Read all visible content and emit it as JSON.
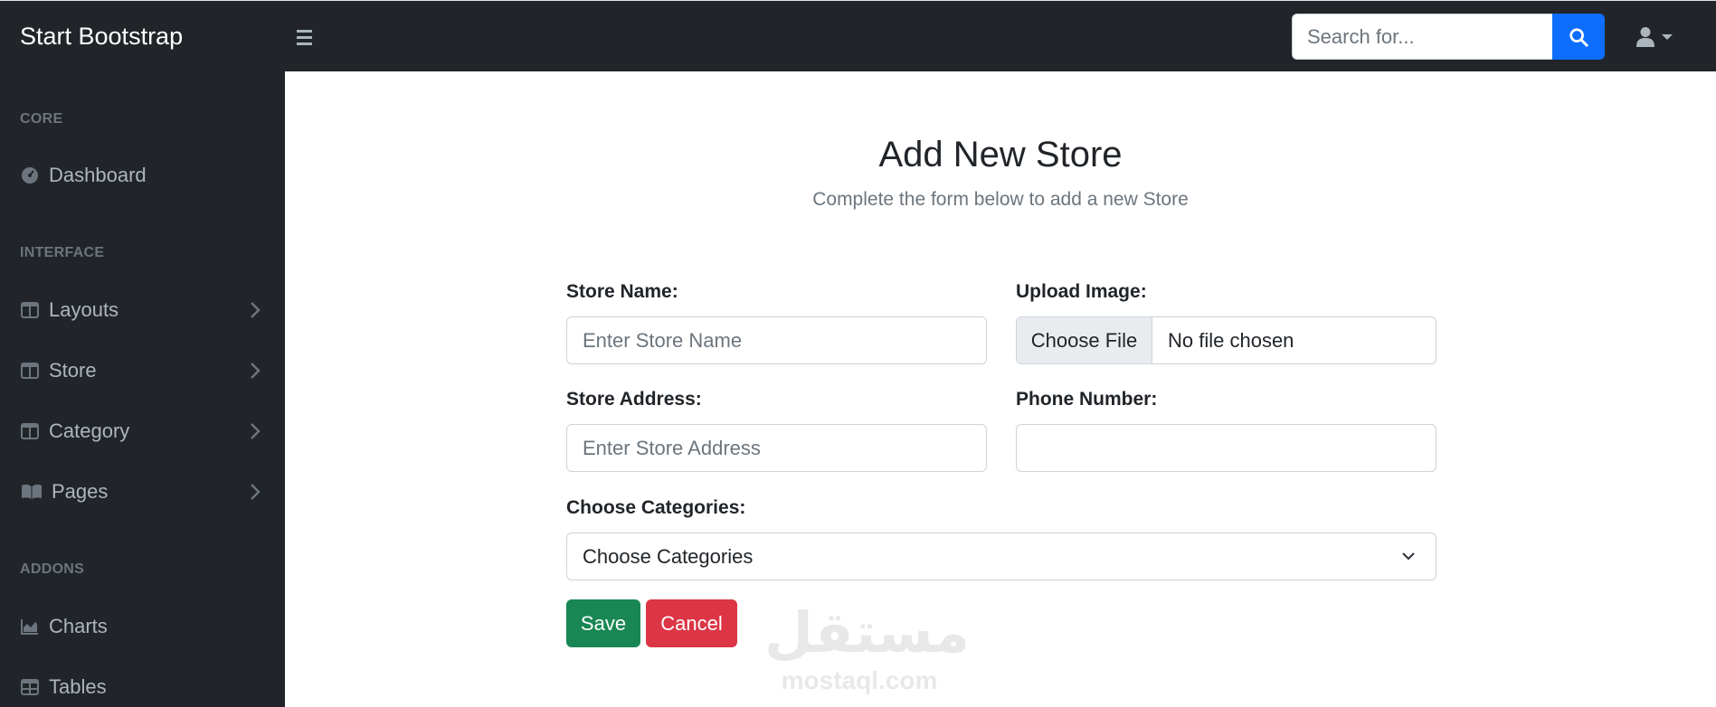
{
  "navbar": {
    "brand": "Start Bootstrap",
    "search_placeholder": "Search for...",
    "toggle_icon": "hamburger-icon",
    "search_icon": "search-icon",
    "user_icon": "user-icon"
  },
  "sidebar": {
    "headings": [
      "CORE",
      "INTERFACE",
      "ADDONS"
    ],
    "items": [
      {
        "label": "Dashboard",
        "icon": "dashboard-icon",
        "has_chevron": false
      },
      {
        "label": "Layouts",
        "icon": "columns-icon",
        "has_chevron": true
      },
      {
        "label": "Store",
        "icon": "columns-icon",
        "has_chevron": true
      },
      {
        "label": "Category",
        "icon": "columns-icon",
        "has_chevron": true
      },
      {
        "label": "Pages",
        "icon": "book-icon",
        "has_chevron": true
      },
      {
        "label": "Charts",
        "icon": "area-chart-icon",
        "has_chevron": false
      },
      {
        "label": "Tables",
        "icon": "table-icon",
        "has_chevron": false
      }
    ]
  },
  "form": {
    "title": "Add New Store",
    "subtitle": "Complete the form below to add a new Store",
    "store_name_label": "Store Name:",
    "store_name_placeholder": "Enter Store Name",
    "upload_label": "Upload Image:",
    "choose_file": "Choose File",
    "no_file": "No file chosen",
    "address_label": "Store Address:",
    "address_placeholder": "Enter Store Address",
    "phone_label": "Phone Number:",
    "phone_value": "",
    "categories_label": "Choose Categories:",
    "categories_selected": "Choose Categories",
    "save": "Save",
    "cancel": "Cancel"
  },
  "watermark": {
    "arabic": "مستقل",
    "latin": "mostaql.com"
  },
  "colors": {
    "dark": "#212529",
    "primary": "#0d6efd",
    "success": "#198754",
    "danger": "#dc3545"
  }
}
